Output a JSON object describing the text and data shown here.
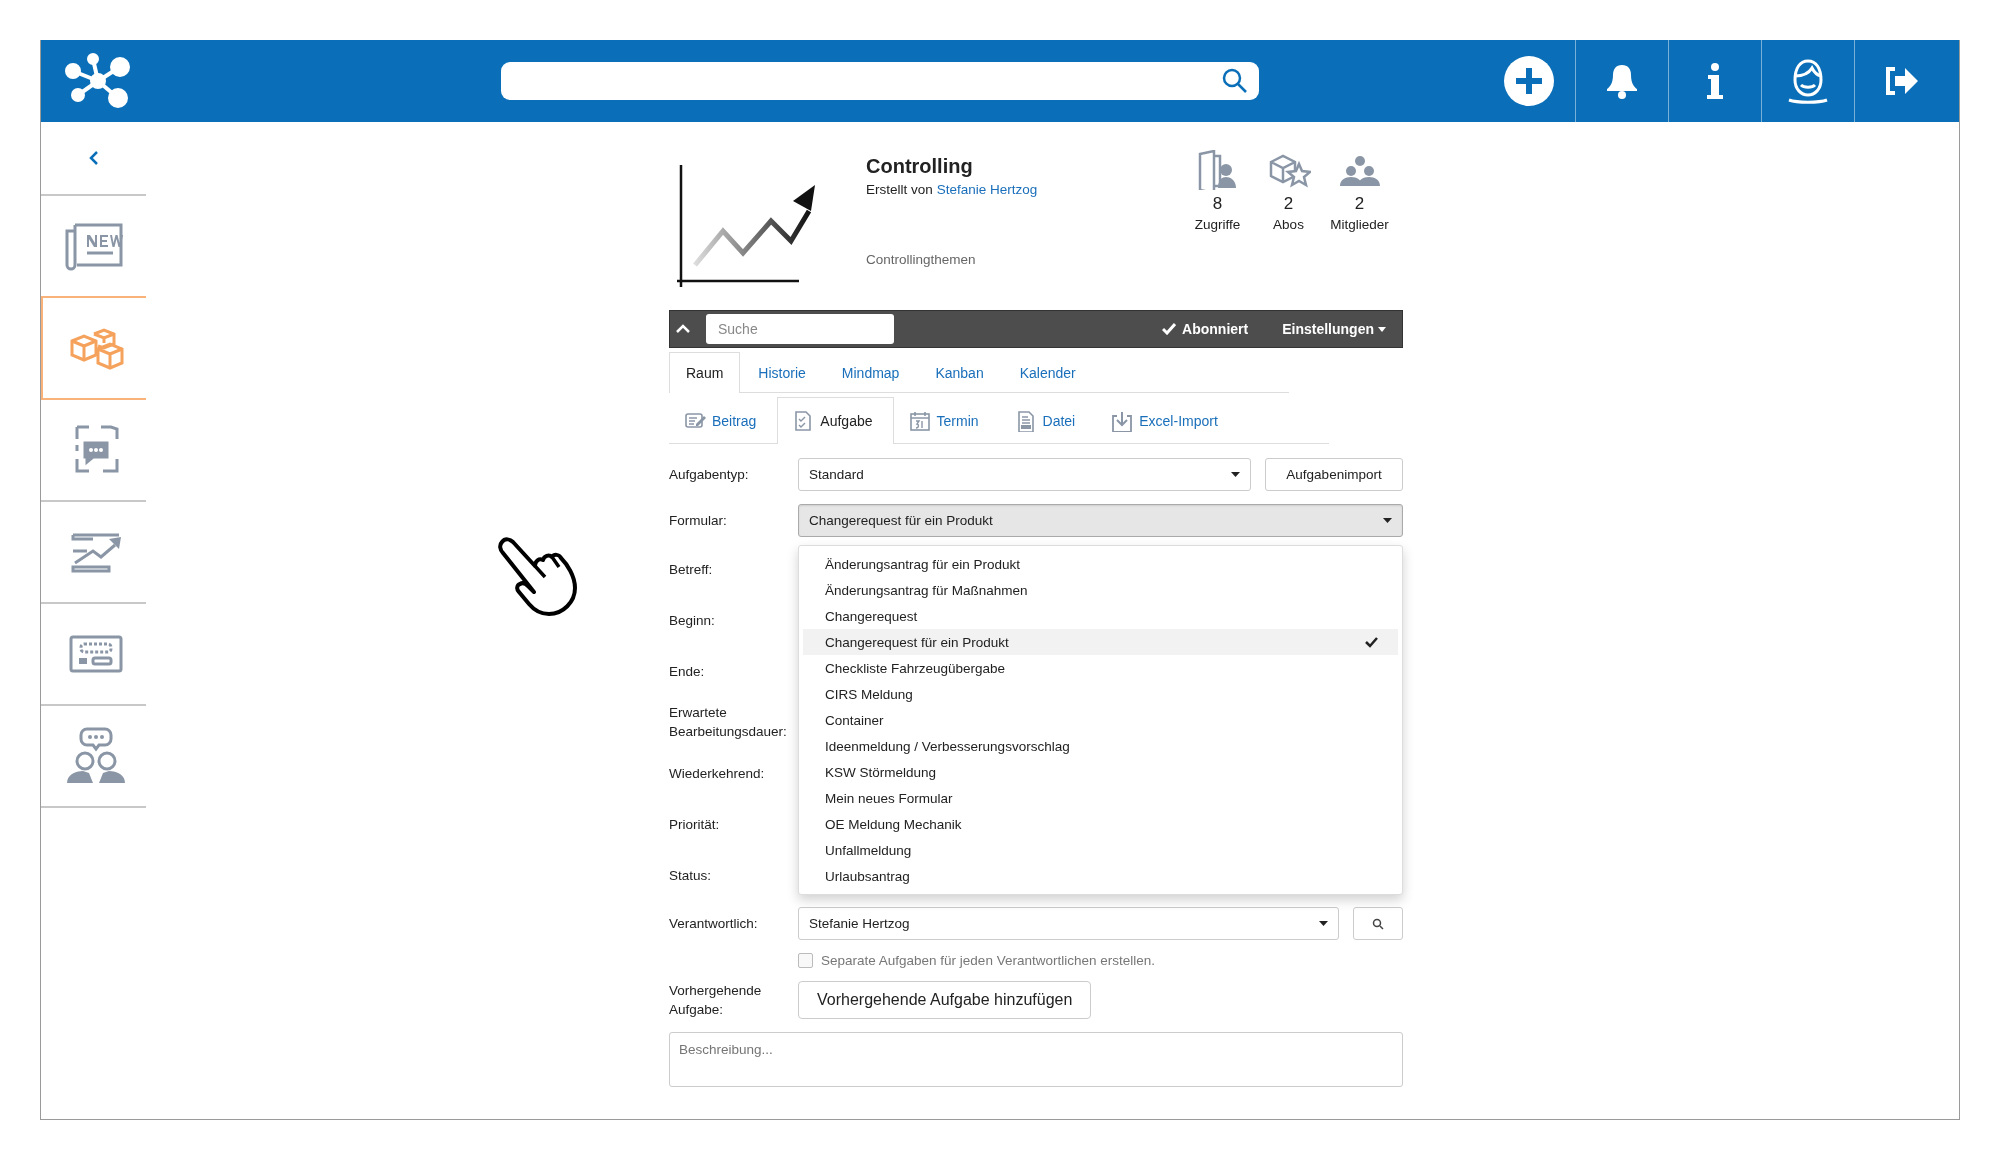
{
  "sidebar": {
    "items": [
      {
        "selected": false
      },
      {
        "selected": true
      },
      {
        "selected": false
      },
      {
        "selected": false
      },
      {
        "selected": false
      },
      {
        "selected": false
      }
    ]
  },
  "room": {
    "title": "Controlling",
    "created_by_label": "Erstellt von",
    "creator": "Stefanie Hertzog",
    "description": "Controllingthemen",
    "stats": [
      {
        "value": "8",
        "label": "Zugriffe"
      },
      {
        "value": "2",
        "label": "Abos"
      },
      {
        "value": "2",
        "label": "Mitglieder"
      }
    ]
  },
  "toolbar": {
    "search_placeholder": "Suche",
    "subscription": {
      "label": "Abonniert",
      "checked": true
    },
    "settings": "Einstellungen"
  },
  "tabs": [
    {
      "label": "Raum",
      "selected": true
    },
    {
      "label": "Historie",
      "selected": false
    },
    {
      "label": "Mindmap",
      "selected": false
    },
    {
      "label": "Kanban",
      "selected": false
    },
    {
      "label": "Kalender",
      "selected": false
    }
  ],
  "create_tabs": [
    {
      "label": "Beitrag",
      "selected": false
    },
    {
      "label": "Aufgabe",
      "selected": true
    },
    {
      "label": "Termin",
      "selected": false
    },
    {
      "label": "Datei",
      "selected": false
    },
    {
      "label": "Excel-Import",
      "selected": false
    }
  ],
  "form": {
    "rows": [
      {
        "kind": "select",
        "label": "Aufgabentyp:",
        "value": "Standard",
        "button": "Aufgabenimport"
      },
      {
        "kind": "select",
        "label": "Formular:",
        "value": "Changerequest für ein Produkt",
        "open": true,
        "options": [
          {
            "label": "Änderungsantrag für ein Produkt",
            "selected": false
          },
          {
            "label": "Änderungsantrag für Maßnahmen",
            "selected": false
          },
          {
            "label": "Changerequest",
            "selected": false
          },
          {
            "label": "Changerequest für ein Produkt",
            "selected": true
          },
          {
            "label": "Checkliste Fahrzeugübergabe",
            "selected": false
          },
          {
            "label": "CIRS Meldung",
            "selected": false
          },
          {
            "label": "Container",
            "selected": false
          },
          {
            "label": "Ideenmeldung / Verbesserungsvorschlag",
            "selected": false
          },
          {
            "label": "KSW Störmeldung",
            "selected": false
          },
          {
            "label": "Mein neues Formular",
            "selected": false
          },
          {
            "label": "OE Meldung Mechanik",
            "selected": false
          },
          {
            "label": "Unfallmeldung",
            "selected": false
          },
          {
            "label": "Urlaubsantrag",
            "selected": false
          }
        ]
      },
      {
        "kind": "covered",
        "label": "Betreff:"
      },
      {
        "kind": "covered",
        "label": "Beginn:"
      },
      {
        "kind": "covered",
        "label": "Ende:"
      },
      {
        "kind": "covered",
        "label": "Erwartete Bearbeitungsdauer:"
      },
      {
        "kind": "covered",
        "label": "Wiederkehrend:"
      },
      {
        "kind": "covered",
        "label": "Priorität:"
      },
      {
        "kind": "covered",
        "label": "Status:"
      },
      {
        "kind": "person-select",
        "label": "Verantwortlich:",
        "value": "Stefanie Hertzog"
      },
      {
        "kind": "checkbox",
        "label": "Separate Aufgaben für jeden Verantwortlichen erstellen.",
        "checked": false
      },
      {
        "kind": "button",
        "label": "Vorhergehende Aufgabe:",
        "button": "Vorhergehende Aufgabe hinzufügen"
      },
      {
        "kind": "textarea",
        "placeholder": "Beschreibung..."
      }
    ]
  }
}
